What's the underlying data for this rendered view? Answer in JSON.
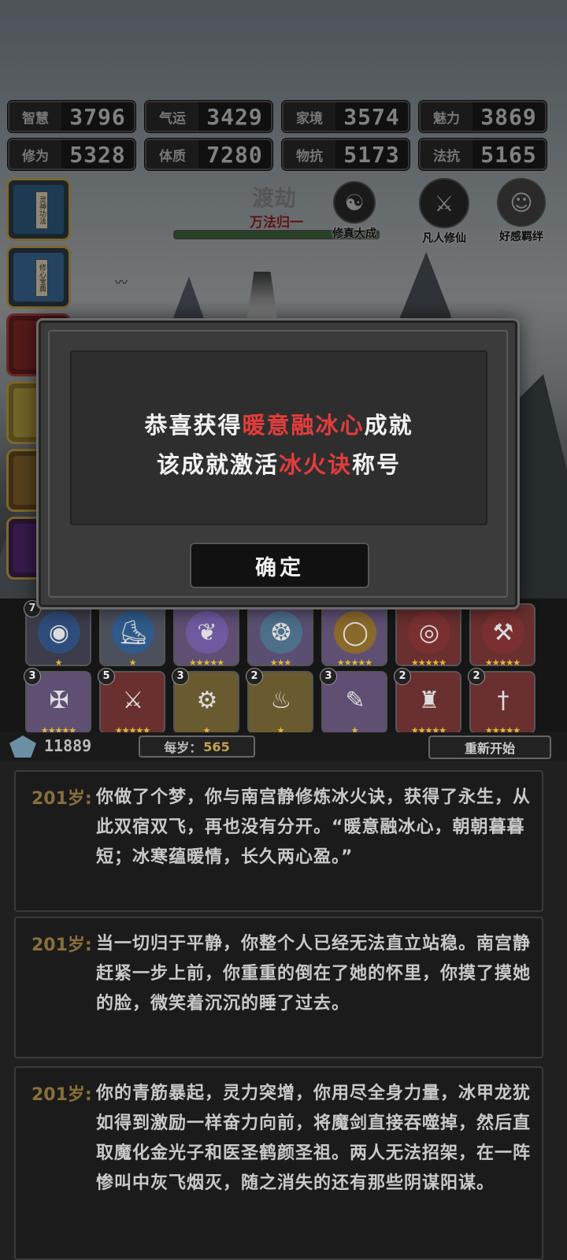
{
  "stats": [
    {
      "label": "智慧",
      "value": "3796"
    },
    {
      "label": "气运",
      "value": "3429"
    },
    {
      "label": "家境",
      "value": "3574"
    },
    {
      "label": "魅力",
      "value": "3869"
    },
    {
      "label": "修为",
      "value": "5328"
    },
    {
      "label": "体质",
      "value": "7280"
    },
    {
      "label": "物抗",
      "value": "5173"
    },
    {
      "label": "法抗",
      "value": "5165"
    }
  ],
  "realm": {
    "name": "渡劫",
    "sub": "万法归一",
    "progress": 1.0
  },
  "badges": [
    {
      "label": "修真大成",
      "icon": "meditation-icon"
    },
    {
      "label": "凡人修仙",
      "icon": "sword-cloud-icon"
    },
    {
      "label": "好感羁绊",
      "icon": "portrait-icon"
    }
  ],
  "books": [
    {
      "icon": "book-icon",
      "tag": "灵神功法"
    },
    {
      "icon": "book-icon",
      "tag": "修心宝典"
    }
  ],
  "modal": {
    "line1_pre": "恭喜获得",
    "line1_hl": "暖意融冰心",
    "line1_post": "成就",
    "line2_pre": "该成就激活",
    "line2_hl": "冰火诀",
    "line2_post": "称号",
    "confirm_label": "确定"
  },
  "items": [
    {
      "icon": "orb-icon",
      "level": "7",
      "stars": "★",
      "color": "#2f4d7a",
      "bg": "#3c3c4a"
    },
    {
      "icon": "boots-icon",
      "level": "",
      "stars": "★",
      "color": "#2f5a8a",
      "bg": "#4c4f5c"
    },
    {
      "icon": "necklace-icon",
      "level": "",
      "stars": "★★★★★",
      "color": "#6f5aa0",
      "bg": "#5e4f73"
    },
    {
      "icon": "pendant-icon",
      "level": "",
      "stars": "★★★",
      "color": "#4d6f8a",
      "bg": "#5a4f73"
    },
    {
      "icon": "ring-icon",
      "level": "",
      "stars": "★★★★★",
      "color": "#8a6a2a",
      "bg": "#5e4f73"
    },
    {
      "icon": "mirror-icon",
      "level": "",
      "stars": "★★★★★",
      "color": "#7a3030",
      "bg": "#6a2f2f"
    },
    {
      "icon": "hammer-icon",
      "level": "",
      "stars": "★★★★★",
      "color": "#7a3030",
      "bg": "#6a2f2f"
    },
    {
      "icon": "crossbow-icon",
      "level": "3",
      "stars": "★★★★★",
      "color": "#5e4f73",
      "bg": "#5e4f73"
    },
    {
      "icon": "axe-icon",
      "level": "5",
      "stars": "★★★★★",
      "color": "#6a2f2f",
      "bg": "#6a2f2f"
    },
    {
      "icon": "wheel-icon",
      "level": "3",
      "stars": "★",
      "color": "#6a5a2f",
      "bg": "#6a5a2f"
    },
    {
      "icon": "bowl-icon",
      "level": "2",
      "stars": "★",
      "color": "#6a5a2f",
      "bg": "#6a5a2f"
    },
    {
      "icon": "scroll-icon",
      "level": "3",
      "stars": "★",
      "color": "#5e4f73",
      "bg": "#5e4f73"
    },
    {
      "icon": "cauldron-icon",
      "level": "2",
      "stars": "★★★★★",
      "color": "#6a2f2f",
      "bg": "#6a2f2f"
    },
    {
      "icon": "sword-icon",
      "level": "2",
      "stars": "★★★★★",
      "color": "#6a2f2f",
      "bg": "#6a2f2f"
    }
  ],
  "status": {
    "gems": "11889",
    "per_age_label": "每岁：",
    "per_age_value": "565",
    "restart_label": "重新开始"
  },
  "log": [
    {
      "age": "201岁:",
      "text": "你做了个梦，你与南宫静修炼冰火诀，获得了永生，从此双宿双飞，再也没有分开。“暖意融冰心，朝朝暮暮短；冰寒蕴暖情，长久两心盈。”"
    },
    {
      "age": "201岁:",
      "text": "当一切归于平静，你整个人已经无法直立站稳。南宫静赶紧一步上前，你重重的倒在了她的怀里，你摸了摸她的脸，微笑着沉沉的睡了过去。"
    },
    {
      "age": "201岁:",
      "text": "你的青筋暴起，灵力突增，你用尽全身力量，冰甲龙犹如得到激励一样奋力向前，将魔剑直接吞噬掉，然后直取魔化金光子和医圣鹤颜圣祖。两人无法招架，在一阵惨叫中灰飞烟灭，随之消失的还有那些阴谋阳谋。"
    }
  ]
}
